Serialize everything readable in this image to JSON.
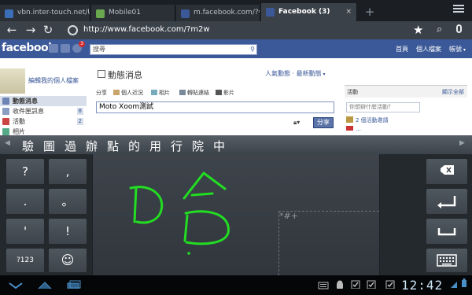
{
  "browser": {
    "tabs": [
      {
        "title": "vbn.inter-touch.net/UI/...",
        "color": "#3a6fb8"
      },
      {
        "title": "Mobile01",
        "color": "#6aa84f"
      },
      {
        "title": "m.facebook.com/?w2m...",
        "color": "#3b5998"
      },
      {
        "title": "Facebook (3)",
        "color": "#3b5998",
        "active": true
      }
    ],
    "new_tab": "+",
    "url": "http://www.facebook.com/?m2w"
  },
  "facebook": {
    "logo": "facebook",
    "notification_count": "3",
    "search_placeholder": "搜尋",
    "nav": [
      "首頁",
      "個人檔案",
      "帳號"
    ],
    "edit_profile": "編輯我的個人檔案",
    "left_nav": [
      {
        "label": "動態消息",
        "count": "",
        "selected": true
      },
      {
        "label": "收件匣訊息",
        "count": "8",
        "selected": false
      },
      {
        "label": "活動",
        "count": "2",
        "selected": false
      },
      {
        "label": "相片",
        "count": "",
        "selected": false
      }
    ],
    "news_title": "動態消息",
    "news_sort": "人氣動態 · 最新動態",
    "share_label": "分享",
    "share_items": [
      "個人近況",
      "相片",
      "轉貼連結",
      "影片"
    ],
    "status_text": "Moto Xoom測試",
    "share_button": "分享",
    "right": {
      "events_heading": "活動",
      "see_all": "顯示全部",
      "events_search": "你想辦什麼活動？",
      "event_invites": "2 個活動邀請",
      "event_more": "…"
    }
  },
  "ime": {
    "candidates": [
      "驗",
      "圖",
      "過",
      "辦",
      "點",
      "的",
      "用",
      "行",
      "院",
      "中"
    ],
    "left_keys": [
      "?",
      ",",
      ".",
      "。",
      "'",
      "!",
      "?123",
      "☺"
    ],
    "symbol_hint": "*#+",
    "ink_color": "#22dd22"
  },
  "system": {
    "clock": "12:42"
  }
}
